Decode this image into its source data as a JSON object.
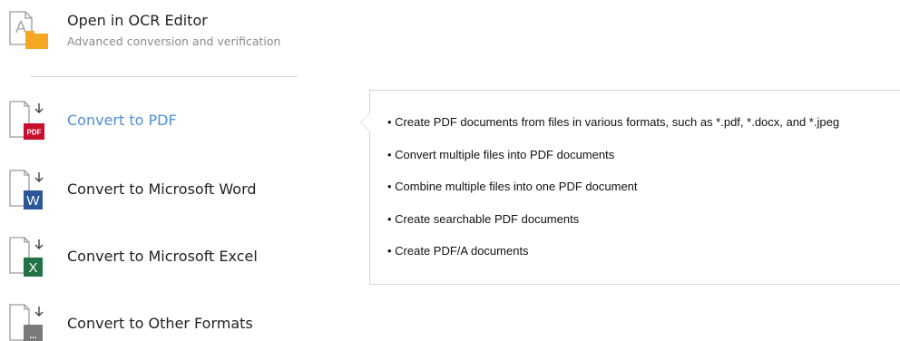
{
  "ocr": {
    "title": "Open in OCR Editor",
    "subtitle": "Advanced conversion and verification",
    "icon": "ocr-editor-icon"
  },
  "menu": [
    {
      "label": "Convert to PDF",
      "icon": "pdf-doc-icon",
      "badge": "PDF",
      "badge_color": "#c8102e",
      "active": true
    },
    {
      "label": "Convert to Microsoft Word",
      "icon": "word-doc-icon",
      "badge": "W",
      "badge_color": "#2b579a",
      "active": false
    },
    {
      "label": "Convert to Microsoft Excel",
      "icon": "excel-doc-icon",
      "badge": "X",
      "badge_color": "#217346",
      "active": false
    },
    {
      "label": "Convert to Other Formats",
      "icon": "other-doc-icon",
      "badge": "...",
      "badge_color": "#7a7a7a",
      "active": false
    }
  ],
  "tooltip": {
    "items": [
      "• Create PDF documents from files in various formats, such as *.pdf, *.docx, and *.jpeg",
      "• Convert multiple files into PDF documents",
      "• Combine multiple files into one PDF document",
      "• Create searchable PDF documents",
      "• Create PDF/A documents"
    ]
  },
  "colors": {
    "accent": "#4f8fd6",
    "ocr_folder": "#f5a623"
  }
}
